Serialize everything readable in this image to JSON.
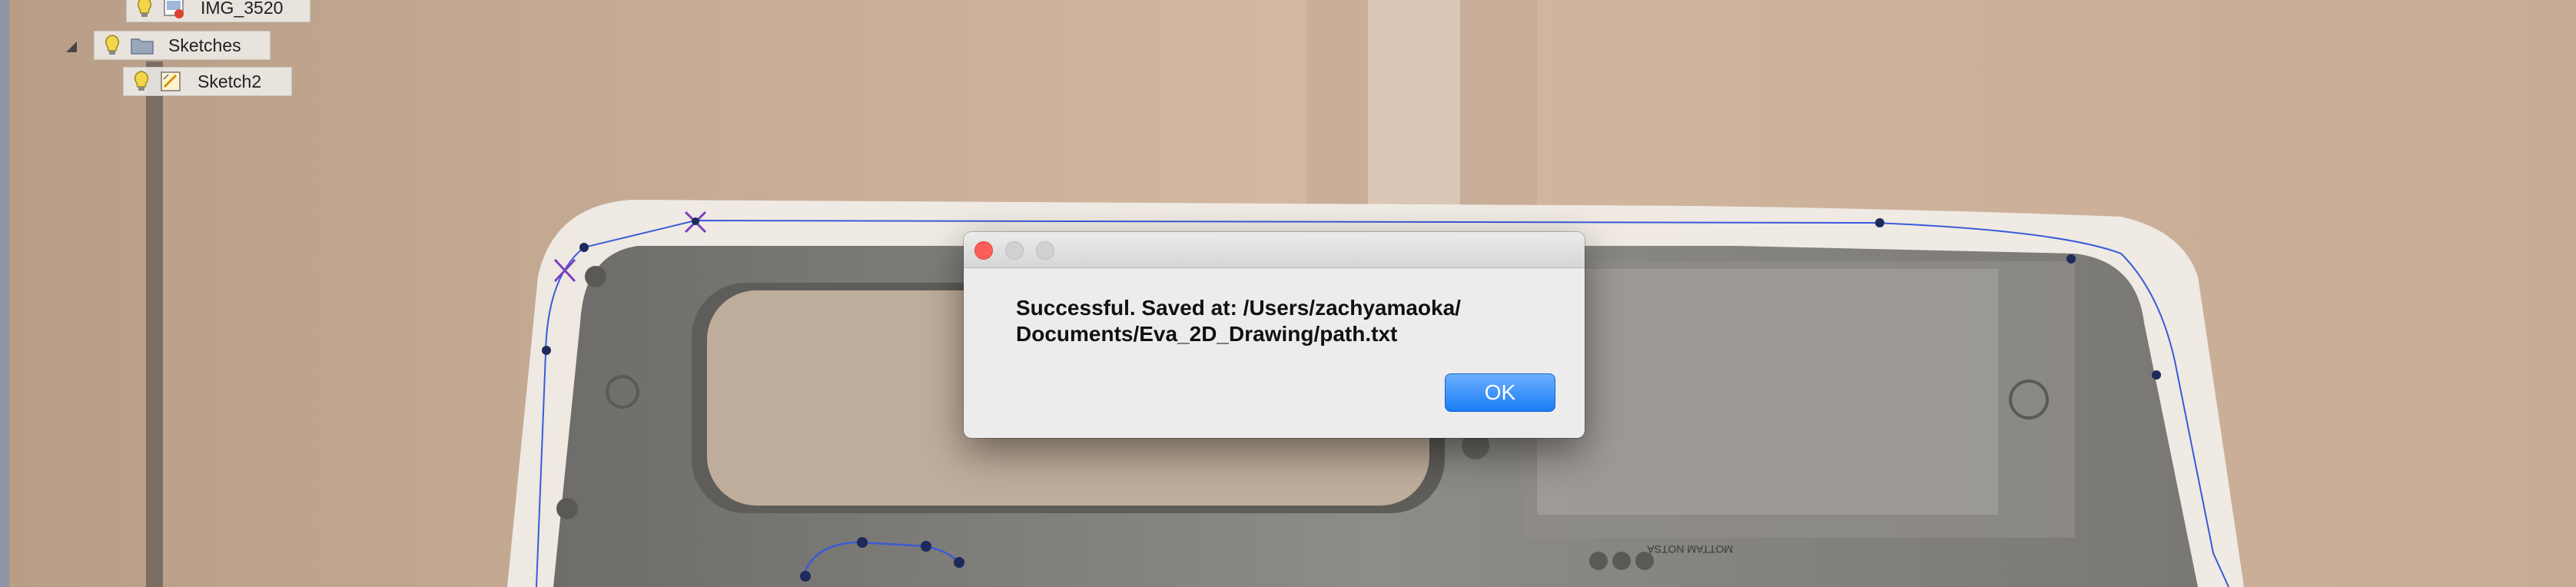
{
  "browser_tree": {
    "nodes": [
      {
        "label": "IMG_3520",
        "icon": "image-canvas-icon",
        "visibility_icon": "lightbulb-icon"
      },
      {
        "label": "Sketches",
        "icon": "folder-icon",
        "visibility_icon": "lightbulb-icon",
        "expanded": true
      },
      {
        "label": "Sketch2",
        "icon": "sketch-icon",
        "visibility_icon": "lightbulb-icon"
      }
    ]
  },
  "dialog": {
    "message_line1": "Successful. Saved at: /Users/zachyamaoka/",
    "message_line2": "Documents/Eva_2D_Drawing/path.txt",
    "ok_label": "OK"
  },
  "canvas": {
    "photo_labels": [
      "ASTON MARTIN",
      "MOTTAM NOTSA"
    ]
  },
  "colors": {
    "background": "#cdb39d",
    "sketch_line": "#3a5bd9",
    "sketch_point": "#1e2a5a",
    "constraint_x": "#7b3fbf",
    "dialog_bg": "#ececec",
    "ok_button": "#1a7cf5",
    "close_button": "#fc5e57"
  }
}
